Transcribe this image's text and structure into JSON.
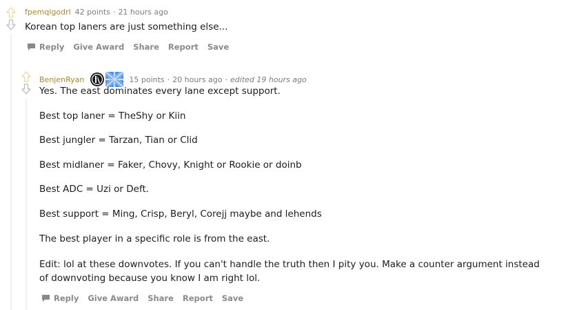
{
  "comments": [
    {
      "author": "fpemqlgodrl",
      "points": "42 points",
      "time": "21 hours ago",
      "paragraphs": [
        "Korean top laners are just something else..."
      ],
      "actions": [
        "Reply",
        "Give Award",
        "Share",
        "Report",
        "Save"
      ]
    },
    {
      "author": "BenjenRyan",
      "points": "15 points",
      "time": "20 hours ago",
      "edited": "edited 19 hours ago",
      "paragraphs": [
        "Yes. The east dominates every lane except support.",
        "Best top laner = TheShy or Kiin",
        "Best jungler = Tarzan, Tian or Clid",
        "Best midlaner = Faker, Chovy, Knight or Rookie or doinb",
        "Best ADC = Uzi or Deft.",
        "Best support = Ming, Crisp, Beryl, Corejj maybe and lehends",
        "The best player in a specific role is from the east.",
        "Edit: lol at these downvotes. If you can't handle the truth then I pity you. Make a counter argument instead of downvoting because you know I am right lol."
      ],
      "actions": [
        "Reply",
        "Give Award",
        "Share",
        "Report",
        "Save"
      ]
    }
  ],
  "colors": {
    "author": "#a58a2a",
    "meta": "#7c7c7c",
    "action": "#878a8c",
    "thread_line": "#edeff1",
    "flair_blue": "#4a90e2"
  }
}
